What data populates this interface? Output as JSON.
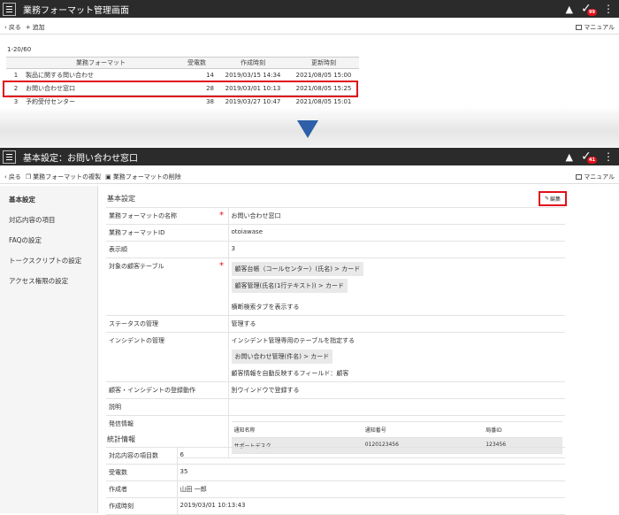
{
  "screen1": {
    "title": "業務フォーマット管理画面",
    "badge": "99",
    "toolbar": {
      "back": "戻る",
      "add": "追加",
      "manual": "マニュアル"
    },
    "count": "1-20/60",
    "columns": [
      "",
      "業務フォーマット",
      "受電数",
      "作成時刻",
      "更新時刻"
    ],
    "rows": [
      {
        "no": "1",
        "name": "製品に関する問い合わせ",
        "calls": "14",
        "created": "2019/03/15 14:34",
        "updated": "2021/08/05 15:00"
      },
      {
        "no": "2",
        "name": "お問い合わせ窓口",
        "calls": "28",
        "created": "2019/03/01 10:13",
        "updated": "2021/08/05 15:25"
      },
      {
        "no": "3",
        "name": "予約受付センター",
        "calls": "38",
        "created": "2019/03/27 10:47",
        "updated": "2021/08/05 15:01"
      }
    ]
  },
  "screen2": {
    "title": "基本設定：お問い合わせ窓口",
    "badge": "41",
    "toolbar": {
      "back": "戻る",
      "copy": "業務フォーマットの複製",
      "delete": "業務フォーマットの削除",
      "manual": "マニュアル"
    },
    "sidebar": [
      "基本設定",
      "対応内容の項目",
      "FAQの設定",
      "トークスクリプトの設定",
      "アクセス権限の設定"
    ],
    "section_basic": "基本設定",
    "edit_label": "編集",
    "fields": {
      "name_label": "業務フォーマットの名称",
      "name_value": "お問い合わせ窓口",
      "id_label": "業務フォーマットID",
      "id_value": "otoiawase",
      "order_label": "表示順",
      "order_value": "3",
      "table_label": "対象の顧客テーブル",
      "table_chip1": "顧客台帳（コールセンター）(氏名) > カード",
      "table_chip2": "顧客管理(氏名(1行テキスト)) > カード",
      "table_note": "横断検索タブを表示する",
      "status_label": "ステータスの管理",
      "status_value": "管理する",
      "incident_label": "インシデントの管理",
      "incident_line1": "インシデント管理専用のテーブルを指定する",
      "incident_chip": "お問い合わせ管理(件名) > カード",
      "incident_line2": "顧客情報を自動反映するフィールド：顧客",
      "register_label": "顧客・インシデントの登録動作",
      "register_value": "別ウインドウで登録する",
      "desc_label": "説明",
      "caller_label": "発信情報",
      "caller_cols": [
        "通知名称",
        "通知番号",
        "局番ID"
      ],
      "caller_row": [
        "サポートデスク",
        "0120123456",
        "123456"
      ]
    },
    "section_stats": "統計情報",
    "stats": [
      {
        "label": "対応内容の項目数",
        "value": "6"
      },
      {
        "label": "受電数",
        "value": "35"
      },
      {
        "label": "作成者",
        "value": "山田 一郎"
      },
      {
        "label": "作成時刻",
        "value": "2019/03/01 10:13:43"
      }
    ]
  }
}
